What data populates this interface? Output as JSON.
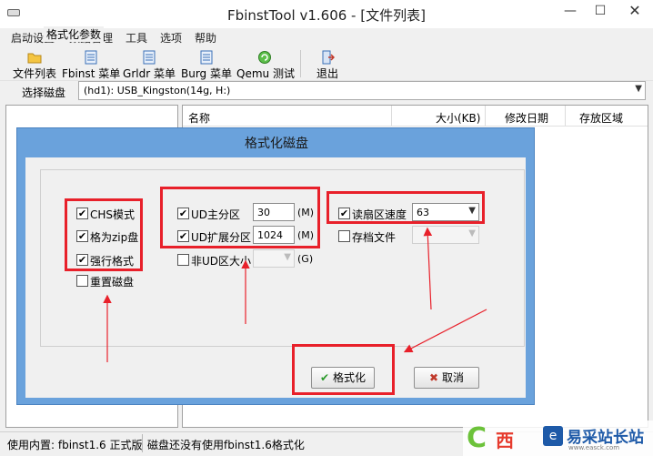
{
  "window": {
    "title": "FbinstTool v1.606 - [文件列表]",
    "minimize_glyph": "—",
    "maximize_glyph": "☐",
    "close_glyph": "✕"
  },
  "menu": [
    "启动设置",
    "数据管理",
    "工具",
    "选项",
    "帮助"
  ],
  "toolbar": {
    "items": [
      {
        "label": "文件列表",
        "icon": "folder-icon"
      },
      {
        "label": "Fbinst 菜单",
        "icon": "menu-doc-icon"
      },
      {
        "label": "Grldr 菜单",
        "icon": "menu-doc-icon"
      },
      {
        "label": "Burg 菜单",
        "icon": "menu-doc-icon"
      },
      {
        "label": "Qemu 测试",
        "icon": "qemu-icon"
      },
      {
        "label": "退出",
        "icon": "exit-icon"
      }
    ]
  },
  "disk": {
    "label": "选择磁盘",
    "value": "(hd1): USB_Kingston(14g, H:)"
  },
  "file_list": {
    "columns": [
      "名称",
      "大小(KB)",
      "修改日期",
      "存放区域"
    ]
  },
  "dialog": {
    "title": "格式化磁盘",
    "group_label": "格式化参数",
    "options": {
      "chs": {
        "label": "CHS模式",
        "checked": true
      },
      "zip": {
        "label": "格为zip盘",
        "checked": true
      },
      "force": {
        "label": "强行格式",
        "checked": true
      },
      "reset": {
        "label": "重置磁盘",
        "checked": false
      },
      "ud_primary": {
        "label": "UD主分区",
        "checked": true,
        "value": "30",
        "unit": "(M)"
      },
      "ud_extended": {
        "label": "UD扩展分区",
        "checked": true,
        "value": "1024",
        "unit": "(M)"
      },
      "non_ud": {
        "label": "非UD区大小",
        "checked": false,
        "value": "",
        "unit": "(G)"
      },
      "read_sector": {
        "label": "读扇区速度",
        "checked": true,
        "value": "63"
      },
      "archive": {
        "label": "存档文件",
        "checked": false,
        "value": ""
      }
    },
    "format_button": "格式化",
    "cancel_button": "取消",
    "check_glyph": "✔",
    "cancel_glyph": "✖"
  },
  "status": {
    "left": "使用内置: fbinst1.6 正式版",
    "right": "磁盘还没有使用fbinst1.6格式化"
  },
  "watermark": {
    "c_glyph": "C",
    "logo_text": "西",
    "blue_glyph": "e",
    "name": "易采站长站",
    "url": "www.easck.com"
  },
  "colors": {
    "highlight_red": "#e8202a",
    "dialog_frame": "#6aa2dc"
  }
}
